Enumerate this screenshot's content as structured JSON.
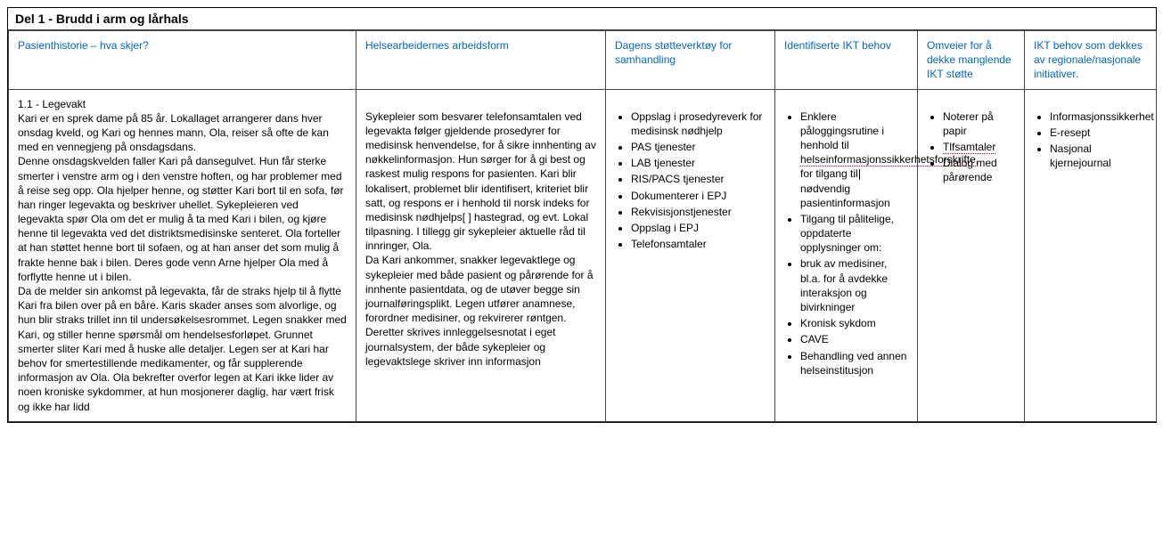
{
  "title": "Del 1 - Brudd i arm og lårhals",
  "headers": {
    "c1": "Pasienthistorie – hva skjer?",
    "c2": "Helsearbeidernes arbeidsform",
    "c3": "Dagens støtteverktøy for samhandling",
    "c4": "Identifiserte IKT behov",
    "c5": "Omveier for å dekke manglende IKT støtte",
    "c6": "IKT behov som dekkes av regionale/nasjonale initiativer."
  },
  "row": {
    "c1": {
      "heading": "1.1 - Legevakt",
      "body": "Kari er en sprek dame på 85 år. Lokallaget arrangerer dans hver onsdag kveld, og Kari og hennes mann, Ola, reiser så ofte de kan med en vennegjeng på onsdagsdans.\nDenne onsdagskvelden faller Kari på dansegulvet. Hun får sterke smerter i venstre arm og i den venstre hoften, og har problemer med å reise seg opp. Ola hjelper henne, og støtter Kari bort til en sofa, før han ringer legevakta og beskriver uhellet. Sykepleieren ved legevakta spør Ola om det er mulig å ta med Kari i bilen, og kjøre henne til legevakta ved det distriktsmedisinske senteret. Ola forteller at han støttet henne bort til sofaen, og at han anser det som mulig å frakte henne bak i bilen. Deres gode venn Arne hjelper Ola med å forflytte henne ut i bilen.\nDa de melder sin ankomst på legevakta, får de straks hjelp til å flytte Kari fra bilen over på en båre. Karis skader anses som alvorlige, og hun blir straks trillet inn til undersøkelsesrommet. Legen snakker med Kari, og stiller henne spørsmål om hendelsesforløpet. Grunnet smerter sliter Kari med å huske alle detaljer. Legen ser at Kari har behov for smertestillende medikamenter, og får supplerende informasjon av Ola. Ola bekrefter overfor legen at Kari ikke lider av noen kroniske sykdommer, at hun mosjonerer daglig, har vært frisk og ikke har lidd"
    },
    "c2": "Sykepleier som besvarer telefonsamtalen ved legevakta følger gjeldende prosedyrer for medisinsk henvendelse, for å sikre innhenting av nøkkelinformasjon. Hun sørger for å gi best og raskest mulig respons for pasienten. Kari blir lokalisert, problemet blir identifisert, kriteriet blir satt, og respons er i henhold til norsk indeks for medisinsk nødhjelps[ ] hastegrad, og evt. Lokal tilpasning. I tillegg gir sykepleier aktuelle råd til innringer, Ola.\nDa Kari ankommer, snakker legevaktlege og sykepleier med både pasient og pårørende for å innhente pasientdata, og de utøver begge sin journalføringsplikt. Legen utfører anamnese, forordner medisiner, og rekvirerer røntgen. Deretter skrives innleggelsesnotat i eget journalsystem, der både sykepleier og legevaktslege skriver inn informasjon",
    "c3": [
      "Oppslag i prosedyreverk for medisinsk nødhjelp",
      "PAS tjenester",
      "LAB tjenester",
      "RIS/PACS tjenester",
      "Dokumenterer i EPJ",
      "Rekvisisjonstjenester",
      "Oppslag i EPJ",
      "Telefonsamtaler"
    ],
    "c4": {
      "item1_prefix": "Enklere påloggingsrutine i henhold til ",
      "item1_underlined": "helseinformasjonssikkerhetsforskrifte",
      "item1_suffix": ", for tilgang til",
      "item1_next": "nødvendig pasientinformasjon",
      "items_rest": [
        "Tilgang til pålitelige, oppdaterte opplysninger om:",
        "bruk av medisiner, bl.a. for å avdekke interaksjon og bivirkninger",
        "Kronisk sykdom",
        "CAVE",
        "Behandling ved annen helseinstitusjon"
      ]
    },
    "c5": {
      "item1": "Noterer på papir",
      "item2_underlined": "Tlfsamtaler",
      "item3": "Dialog med pårørende"
    },
    "c6": [
      "Informasjonssikkerhet",
      "E-resept",
      "Nasjonal kjernejournal"
    ]
  }
}
